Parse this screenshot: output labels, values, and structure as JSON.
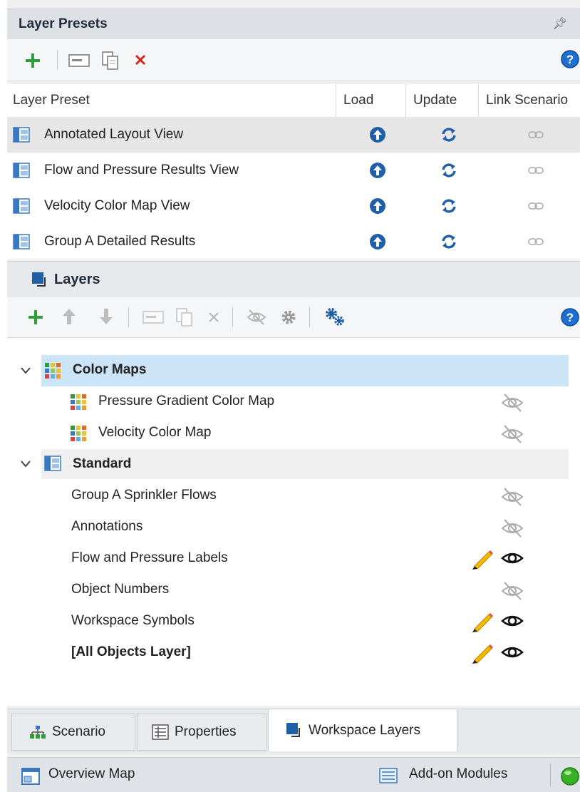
{
  "presets": {
    "title": "Layer Presets",
    "pin_icon": "pin-icon",
    "columns": [
      "Layer Preset",
      "Load",
      "Update",
      "Link Scenario"
    ],
    "rows": [
      {
        "name": "Annotated Layout View"
      },
      {
        "name": "Flow and Pressure Results View"
      },
      {
        "name": "Velocity Color Map View"
      },
      {
        "name": "Group A Detailed Results"
      }
    ]
  },
  "layers": {
    "title": "Layers",
    "groups": [
      {
        "label": "Color Maps",
        "icon": "color-map-icon",
        "items": [
          {
            "label": "Pressure Gradient Color Map",
            "visible": false,
            "editable": false
          },
          {
            "label": "Velocity Color Map",
            "visible": false,
            "editable": false
          }
        ]
      },
      {
        "label": "Standard",
        "icon": "layer-group-icon",
        "items": [
          {
            "label": "Group A Sprinkler Flows",
            "visible": false,
            "editable": false
          },
          {
            "label": "Annotations",
            "visible": false,
            "editable": false
          },
          {
            "label": "Flow and Pressure Labels",
            "visible": true,
            "editable": true
          },
          {
            "label": "Object Numbers",
            "visible": false,
            "editable": false
          },
          {
            "label": "Workspace Symbols",
            "visible": true,
            "editable": true
          },
          {
            "label": "[All Objects Layer]",
            "visible": true,
            "editable": true
          }
        ]
      }
    ]
  },
  "tabs": [
    {
      "label": "Scenario",
      "icon": "scenario-icon",
      "active": false
    },
    {
      "label": "Properties",
      "icon": "properties-icon",
      "active": false
    },
    {
      "label": "Workspace Layers",
      "icon": "workspace-layers-icon",
      "active": true
    }
  ],
  "status": {
    "overview": "Overview Map",
    "addon": "Add-on Modules"
  },
  "colors": {
    "accent_blue": "#1f5fa8",
    "add_green": "#2e9d3a",
    "delete_red": "#d9261c",
    "selected_row": "#cce4f7"
  }
}
